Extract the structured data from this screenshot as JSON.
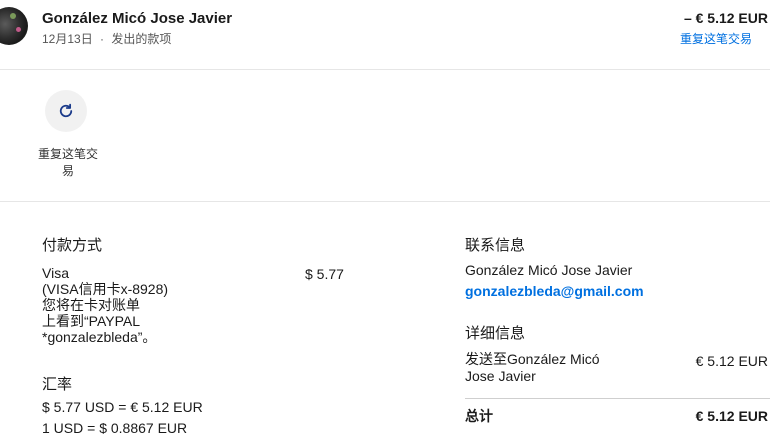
{
  "header": {
    "name": "González Micó Jose Javier",
    "date": "12月13日",
    "separator": "·",
    "type": "发出的款项",
    "amount": "– € 5.12 EUR",
    "repeat_link": "重复这笔交易"
  },
  "actions": {
    "repeat_icon": "refresh-icon",
    "repeat_label": "重复这笔交易"
  },
  "payment": {
    "title": "付款方式",
    "method_lines": [
      "Visa",
      "(VISA信用卡x-8928)",
      "您将在卡对账单",
      "上看到“PAYPAL",
      "*gonzalezbleda”。"
    ],
    "amount": "$ 5.77"
  },
  "exchange": {
    "title": "汇率",
    "line1": "$ 5.77 USD = € 5.12 EUR",
    "line2": "1 USD = $ 0.8867 EUR"
  },
  "contact": {
    "title": "联系信息",
    "name": "González Micó Jose Javier",
    "email": "gonzalezbleda@gmail.com"
  },
  "details": {
    "title": "详细信息",
    "description_line1": "发送至González Micó",
    "description_line2": "Jose Javier",
    "amount": "€ 5.12 EUR",
    "total_label": "总计",
    "total_amount": "€ 5.12 EUR"
  },
  "colors": {
    "link": "#0070e0",
    "divider": "#e6e6e6"
  }
}
